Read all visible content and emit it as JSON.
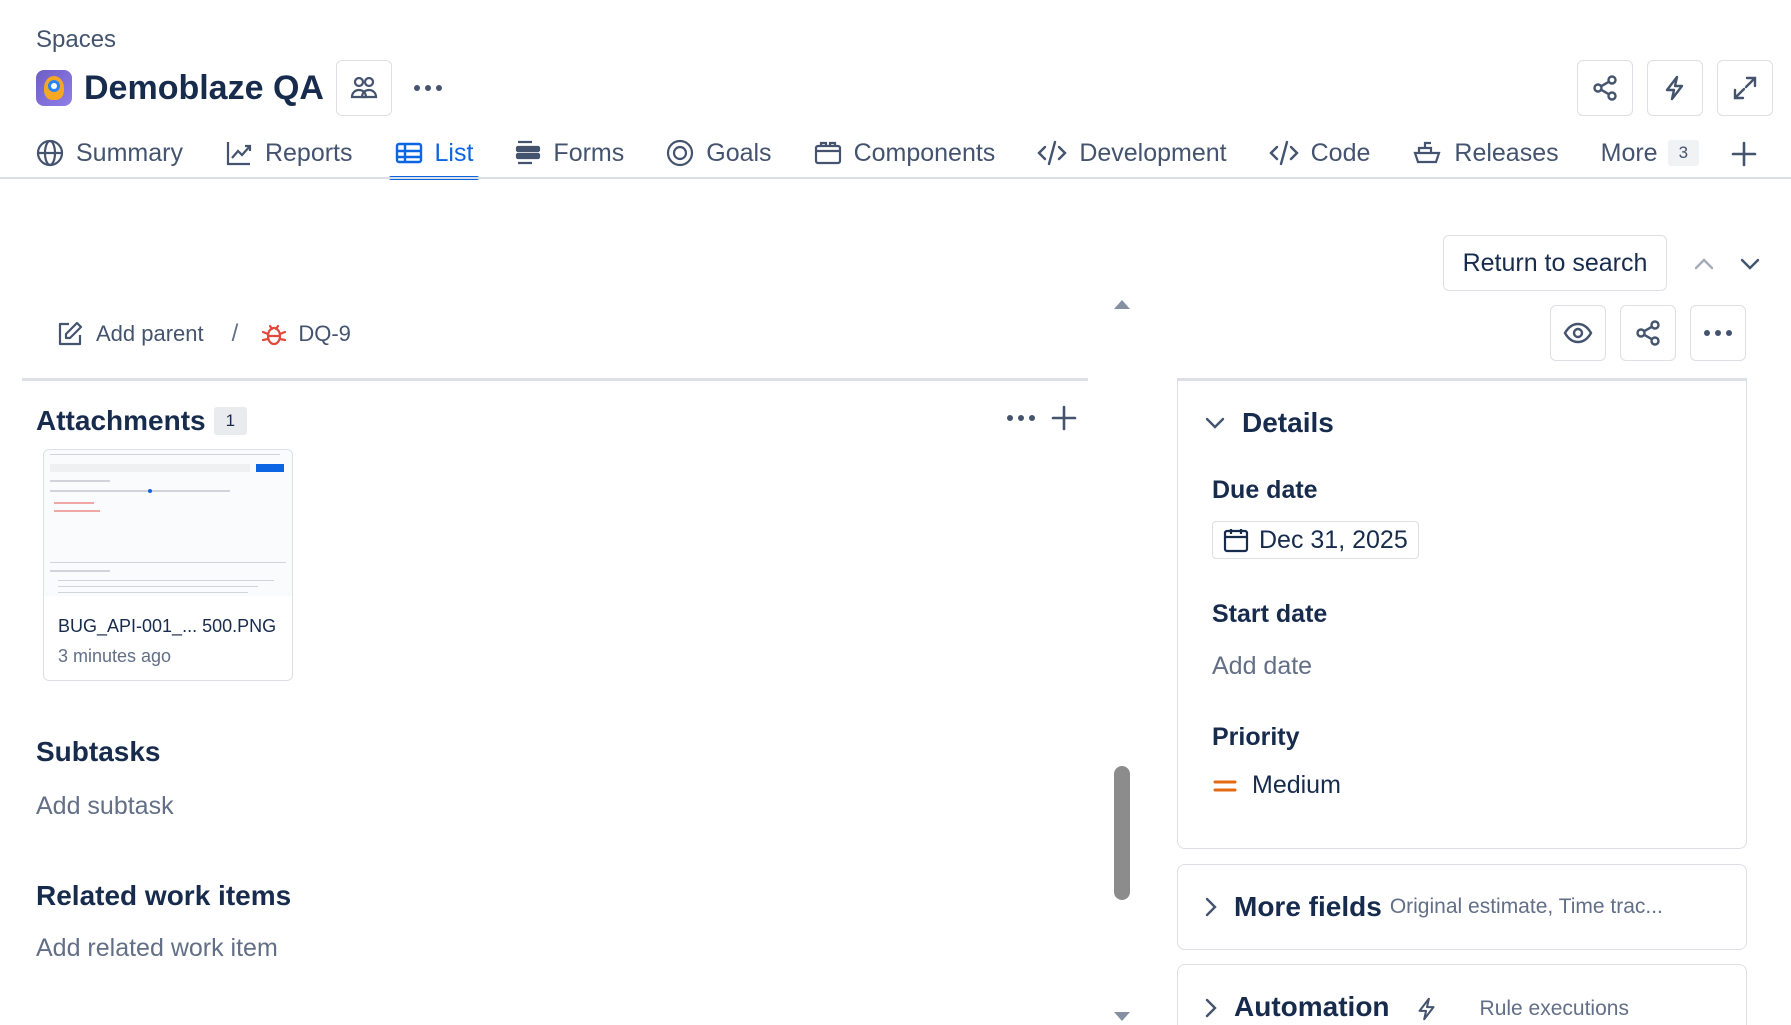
{
  "header": {
    "breadcrumb": "Spaces",
    "project_name": "Demoblaze QA"
  },
  "tabs": [
    {
      "label": "Summary",
      "icon": "globe-icon"
    },
    {
      "label": "Reports",
      "icon": "chart-line-icon"
    },
    {
      "label": "List",
      "icon": "table-icon",
      "active": true
    },
    {
      "label": "Forms",
      "icon": "forms-icon"
    },
    {
      "label": "Goals",
      "icon": "target-icon"
    },
    {
      "label": "Components",
      "icon": "components-icon"
    },
    {
      "label": "Development",
      "icon": "code-icon"
    },
    {
      "label": "Code",
      "icon": "code-icon"
    },
    {
      "label": "Releases",
      "icon": "ship-icon"
    },
    {
      "label": "More",
      "count": "3"
    }
  ],
  "toolbar": {
    "return_to_search": "Return to search"
  },
  "issue": {
    "add_parent": "Add parent",
    "separator": "/",
    "key": "DQ-9"
  },
  "attachments": {
    "title": "Attachments",
    "count": "1",
    "file_name": "BUG_API-001_... 500.PNG",
    "file_time": "3 minutes ago"
  },
  "subtasks": {
    "title": "Subtasks",
    "placeholder": "Add subtask"
  },
  "related": {
    "title": "Related work items",
    "placeholder": "Add related work item"
  },
  "details": {
    "title": "Details",
    "due_date_label": "Due date",
    "due_date_value": "Dec 31, 2025",
    "start_date_label": "Start date",
    "start_date_placeholder": "Add date",
    "priority_label": "Priority",
    "priority_value": "Medium",
    "priority_color": "#e56910"
  },
  "more_fields": {
    "title": "More fields",
    "subtitle": "Original estimate, Time trac..."
  },
  "automation": {
    "title": "Automation",
    "subtitle": "Rule executions"
  },
  "colors": {
    "accent": "#0c66e4",
    "text": "#172b4d",
    "subtle": "#626f86",
    "border": "#dcdfe4",
    "bug": "#e2483d"
  }
}
